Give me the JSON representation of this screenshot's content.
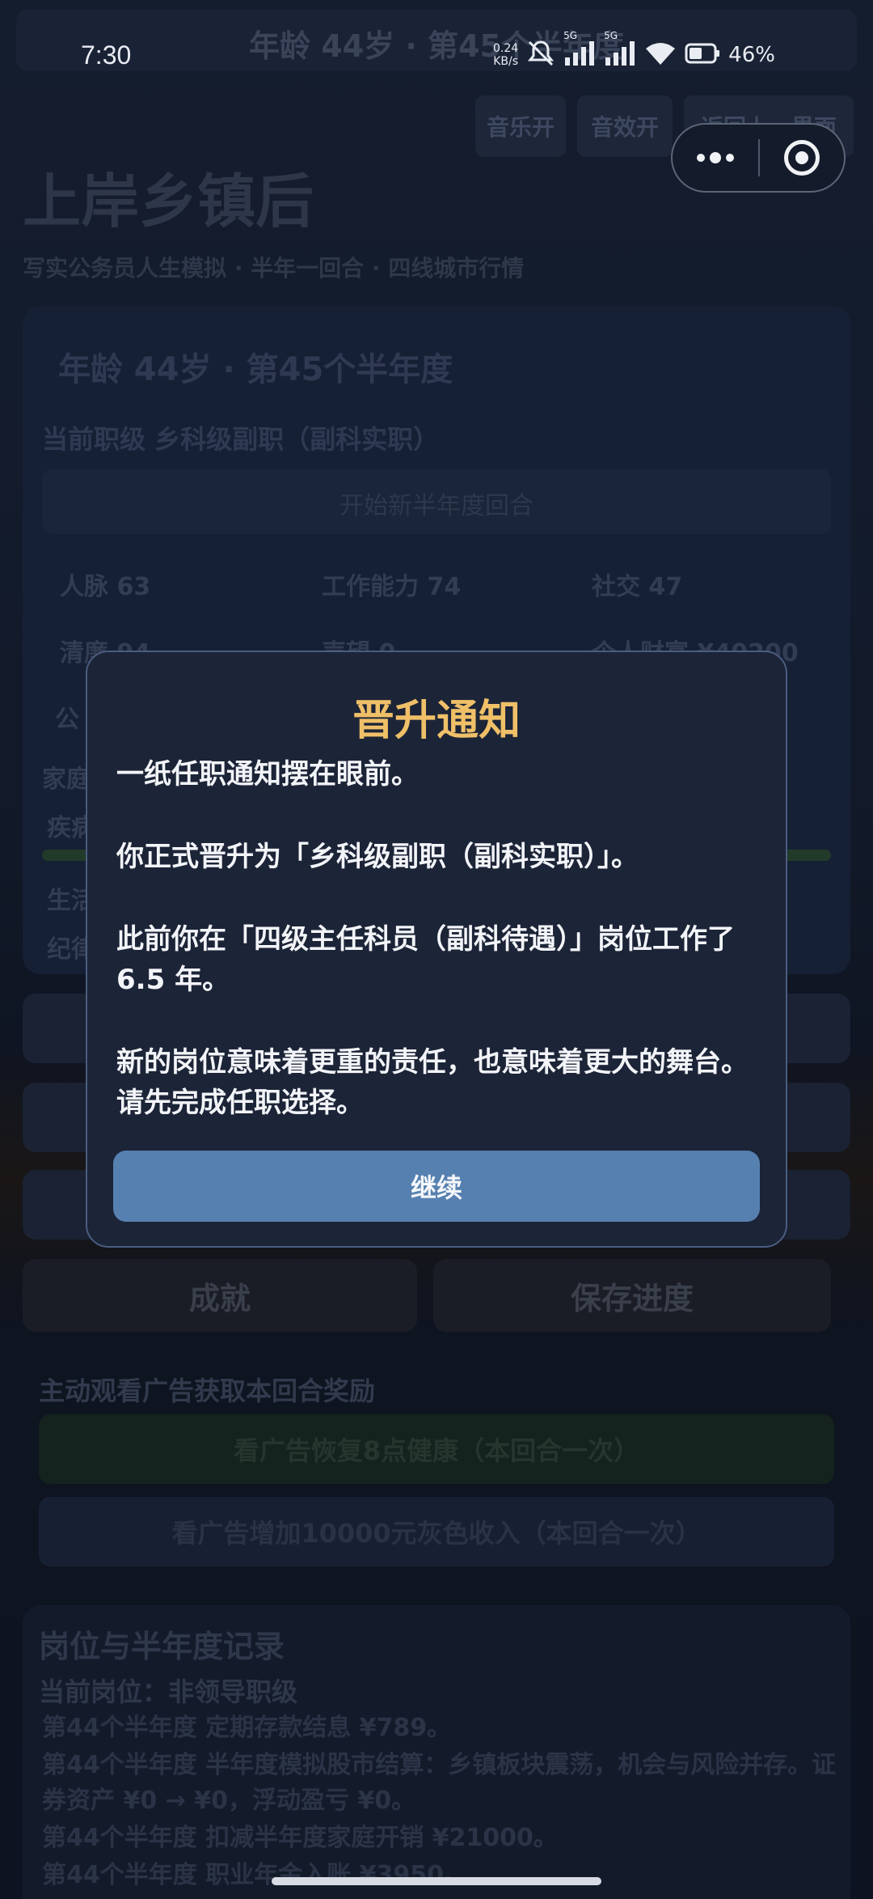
{
  "status_bar": {
    "time": "7:30",
    "net_speed_value": "0.24",
    "net_speed_unit": "KB/s",
    "sim1": "5G",
    "sim2": "5G",
    "battery": "46%"
  },
  "header": {
    "top_title": "年龄 44岁 · 第45个半年度",
    "music_button": "音乐开",
    "sfx_button": "音效开",
    "back_button": "返回上一界面",
    "app_title": "上岸乡镇后",
    "app_subtitle": "写实公务员人生模拟 · 半年一回合 · 四线城市行情"
  },
  "panel": {
    "age_line": "年龄 44岁 · 第45个半年度",
    "rank_line": "当前职级 乡科级副职（副科实职）",
    "progress_text": "开始新半年度回合",
    "stats": [
      {
        "label": "人脉",
        "value": "63"
      },
      {
        "label": "工作能力",
        "value": "74"
      },
      {
        "label": "社交",
        "value": "47"
      },
      {
        "label": "清廉",
        "value": "94"
      },
      {
        "label": "声望",
        "value": "0"
      },
      {
        "label": "个人财富",
        "value": "¥40200"
      }
    ],
    "row_labels": [
      "公",
      "家庭",
      "疾病",
      "生活",
      "纪律"
    ]
  },
  "actions": {
    "achievements_button": "成就",
    "save_button": "保存进度",
    "ad_section_title": "主动观看广告获取本回合奖励",
    "ad_health_button": "看广告恢复8点健康（本回合一次）",
    "ad_income_button": "看广告增加10000元灰色收入（本回合一次）"
  },
  "records": {
    "title": "岗位与半年度记录",
    "current_post": "当前岗位：非领导职级",
    "lines": [
      "第44个半年度 定期存款结息 ¥789。",
      "第44个半年度 半年度模拟股市结算：乡镇板块震荡，机会与风险并存。证券资产 ¥0 → ¥0，浮动盈亏 ¥0。",
      "第44个半年度 扣减半年度家庭开销 ¥21000。",
      "第44个半年度 职业年金入账 ¥3950。"
    ]
  },
  "modal": {
    "title": "晋升通知",
    "paragraphs": [
      "一纸任职通知摆在眼前。",
      "你正式晋升为「乡科级副职（副科实职）」。",
      "此前你在「四级主任科员（副科待遇）」岗位工作了 6.5 年。",
      "新的岗位意味着更重的责任，也意味着更大的舞台。请先完成任职选择。"
    ],
    "continue_button": "继续"
  },
  "colors": {
    "modal_title": "#efc068",
    "continue_button": "#5680b0",
    "modal_bg": "#1c2437"
  }
}
